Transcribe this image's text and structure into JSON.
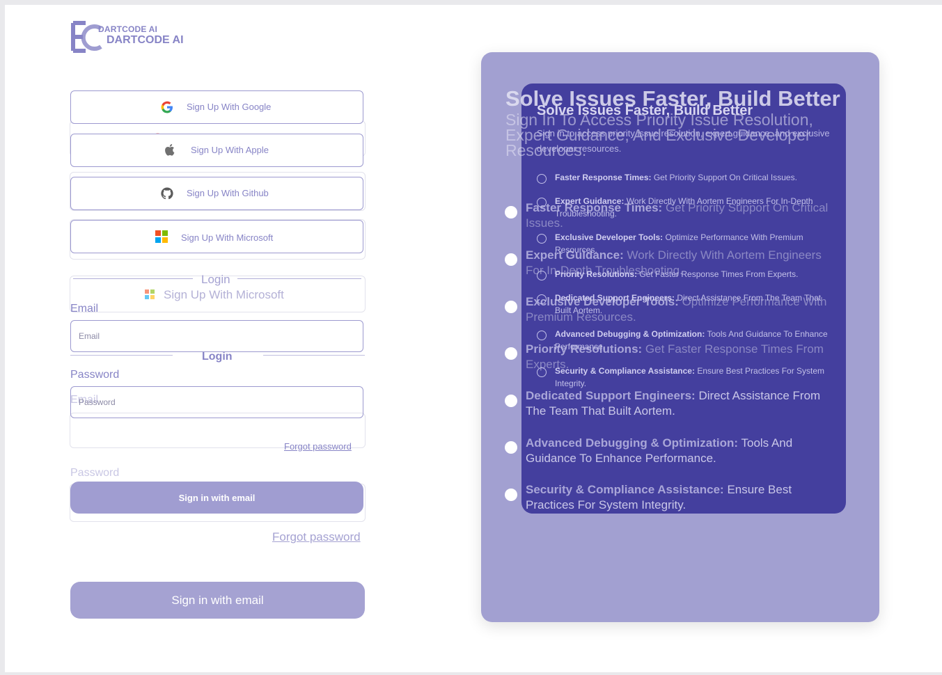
{
  "brand": {
    "name_small": "DARTCODE AI",
    "name_big": "DARTCODE AI"
  },
  "buttons": {
    "google": "Sign Up With Google",
    "apple": "Sign Up With Apple",
    "github": "Sign Up With Github",
    "microsoft": "Sign Up With Microsoft"
  },
  "login": {
    "divider": "Login",
    "email_label": "Email",
    "email_placeholder": "Email",
    "password_label": "Password",
    "password_placeholder": "Password",
    "forgot": "Forgot password",
    "submit": "Sign in with email"
  },
  "panel": {
    "title": "Solve Issues Faster, Build Better",
    "subtitle": "Sign In To Access Priority Issue Resolution, Expert Guidance, And Exclusive Developer Resources.",
    "inner_subtitle": "Sign in to access priority issue resolution, expert guidance, and exclusive developer resources.",
    "features": [
      {
        "title": "Faster Response Times:",
        "text": "Get Priority Support On Critical Issues."
      },
      {
        "title": "Expert Guidance:",
        "text": "Work Directly With Aortem Engineers For In-Depth Troubleshooting."
      },
      {
        "title": "Exclusive Developer Tools:",
        "text": "Optimize Performance With Premium Resources."
      },
      {
        "title": "Priority Resolutions:",
        "text": "Get Faster Response Times From Experts."
      },
      {
        "title": "Dedicated Support Engineers:",
        "text": "Direct Assistance From The Team That Built Aortem."
      },
      {
        "title": "Advanced Debugging & Optimization:",
        "text": "Tools And Guidance To Enhance Performance."
      },
      {
        "title": "Security & Compliance Assistance:",
        "text": "Ensure Best Practices For System Integrity."
      }
    ]
  },
  "colors": {
    "accent": "#8784c6",
    "panel_outer": "#a2a0d1",
    "panel_inner": "#443f9e",
    "button_fill": "#a09dd1"
  }
}
